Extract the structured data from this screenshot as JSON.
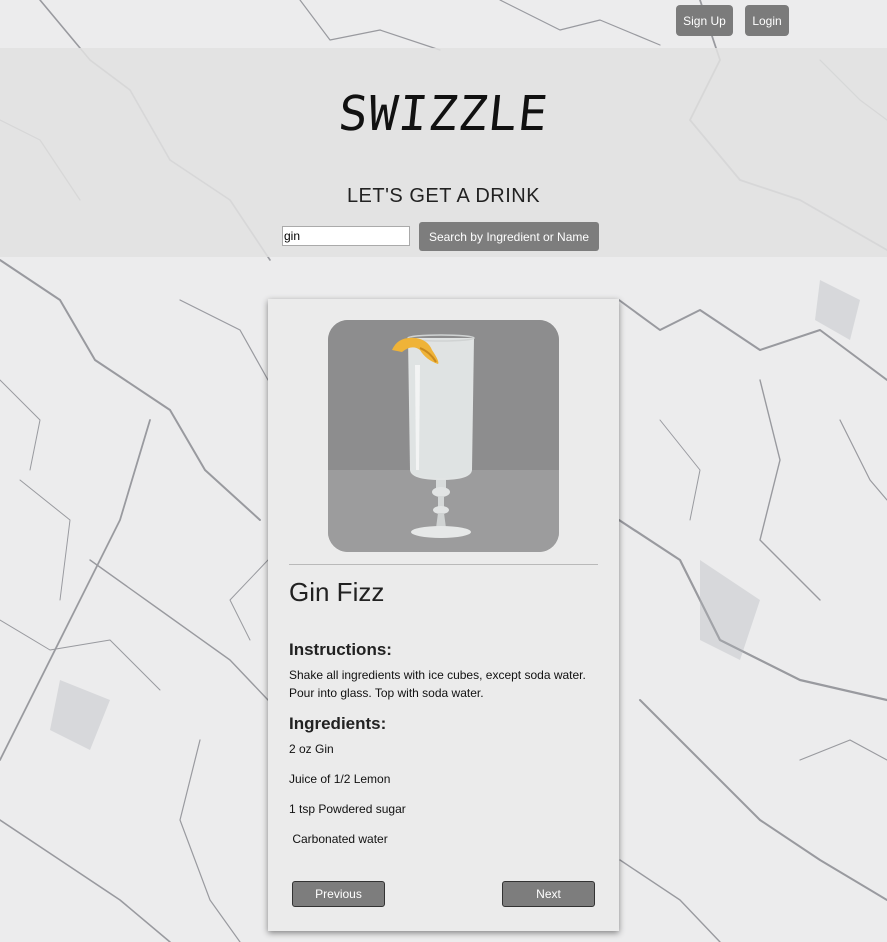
{
  "header": {
    "signup_label": "Sign Up",
    "login_label": "Login"
  },
  "hero": {
    "logo": "SWIZZLE",
    "tagline": "LET'S GET A DRINK"
  },
  "search": {
    "value": "gin",
    "button_label": "Search by Ingredient or Name"
  },
  "drink": {
    "name": "Gin Fizz",
    "instructions_title": "Instructions:",
    "instructions": "Shake all ingredients with ice cubes, except soda water. Pour into glass. Top with soda water.",
    "ingredients_title": "Ingredients:",
    "ingredients": [
      "2 oz Gin",
      "Juice of 1/2 Lemon",
      "1 tsp Powdered sugar",
      " Carbonated water"
    ]
  },
  "pager": {
    "previous_label": "Previous",
    "next_label": "Next"
  },
  "colors": {
    "button_gray": "#7b7b7b",
    "card_bg": "#ebebeb",
    "hero_overlay": "#e1e1e1"
  }
}
